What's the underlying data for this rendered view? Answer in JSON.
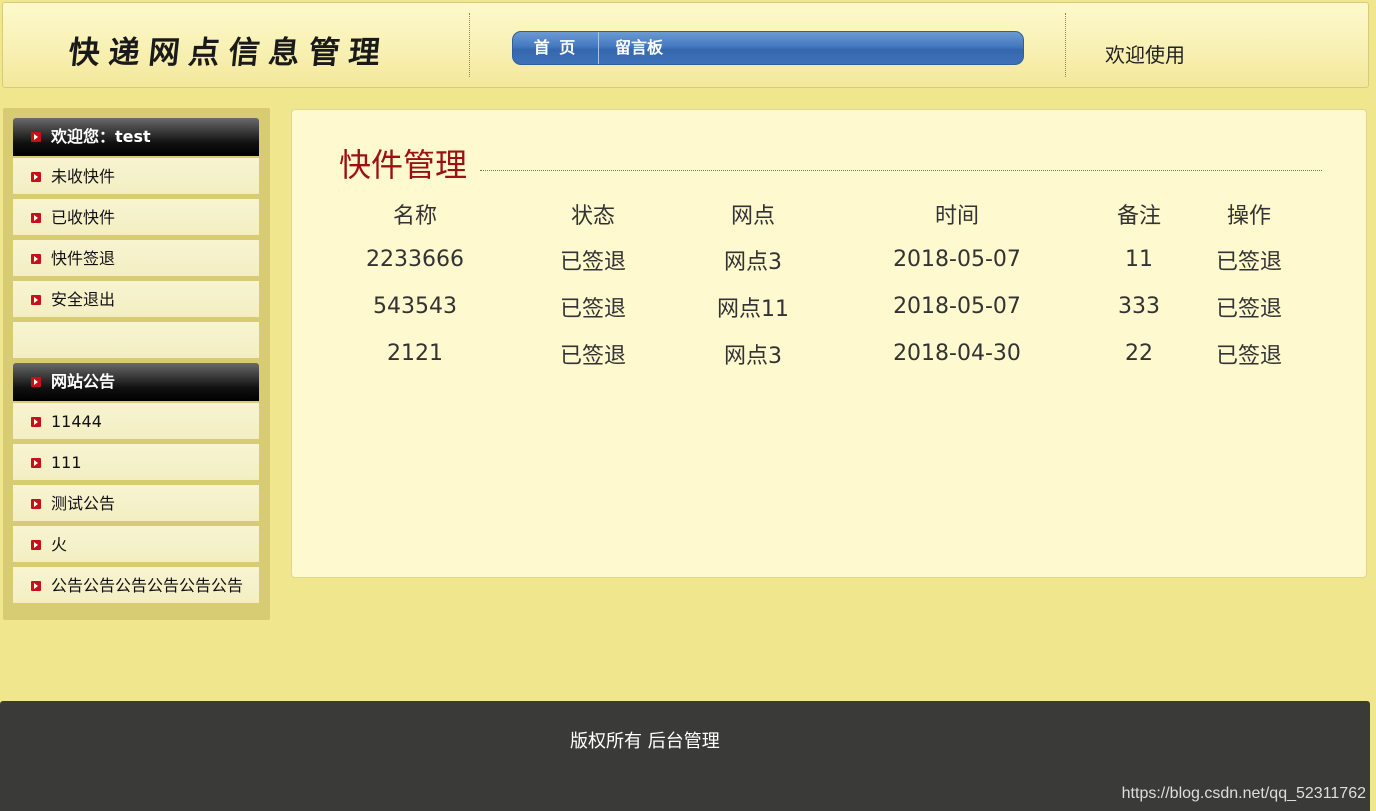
{
  "header": {
    "site_title": "快递网点信息管理",
    "nav": {
      "home": "首 页",
      "message_board": "留言板"
    },
    "welcome": "欢迎使用"
  },
  "sidebar": {
    "user_heading": "欢迎您：test",
    "menu": [
      "未收快件",
      "已收快件",
      "快件签退",
      "安全退出"
    ],
    "notice_heading": "网站公告",
    "notices": [
      "11444",
      "111",
      "测试公告",
      "火",
      "公告公告公告公告公告公告"
    ]
  },
  "main": {
    "title": "快件管理",
    "columns": [
      "名称",
      "状态",
      "网点",
      "时间",
      "备注",
      "操作"
    ],
    "rows": [
      {
        "name": "2233666",
        "status": "已签退",
        "point": "网点3",
        "time": "2018-05-07",
        "note": "11",
        "action": "已签退"
      },
      {
        "name": "543543",
        "status": "已签退",
        "point": "网点11",
        "time": "2018-05-07",
        "note": "333",
        "action": "已签退"
      },
      {
        "name": "2121",
        "status": "已签退",
        "point": "网点3",
        "time": "2018-04-30",
        "note": "22",
        "action": "已签退"
      }
    ]
  },
  "footer": {
    "copyright": "版权所有 后台管理",
    "watermark": "https://blog.csdn.net/qq_52311762"
  },
  "colors": {
    "page_bg": "#efe68e",
    "panel_title": "#9b1113",
    "nav_blue": "#4479bf",
    "footer_bg": "#3a3b39"
  }
}
